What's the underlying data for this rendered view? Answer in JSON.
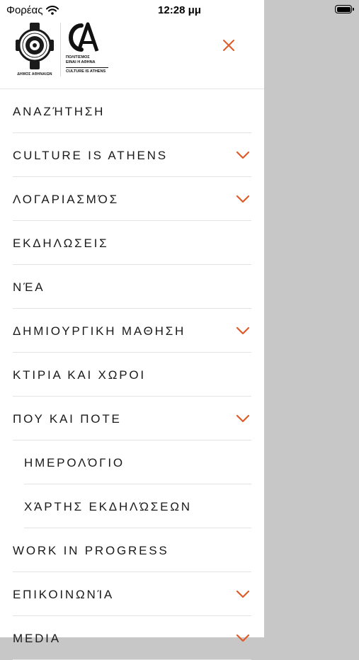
{
  "status_bar": {
    "carrier": "Φορέας",
    "time": "12:28 μμ"
  },
  "header": {
    "dimos_caption": "ΔΗΜΟΣ ΑΘΗΝΑΙΩΝ",
    "ca_line1": "ΠΟΛΙΤΙΣΜΟΣ",
    "ca_line2": "ΕΙΝΑΙ Η ΑΘΗΝΑ",
    "ca_line3": "CULTURE IS ATHENS",
    "close_icon": "close-icon"
  },
  "colors": {
    "accent": "#e05a28",
    "overlay": "#c7c7c7",
    "text": "#1a1a1a"
  },
  "menu": {
    "items": [
      {
        "label": "ΑΝΑΖΉΤΗΣΗ",
        "expandable": false
      },
      {
        "label": "CULTURE IS ATHENS",
        "expandable": true
      },
      {
        "label": "ΛΟΓΑΡΙΑΣΜΌΣ",
        "expandable": true
      },
      {
        "label": "ΕΚΔΗΛΩΣΕΙΣ",
        "expandable": false
      },
      {
        "label": "ΝΈΑ",
        "expandable": false
      },
      {
        "label": "ΔΗΜΙΟΥΡΓΙΚΗ ΜΑΘΗΣΗ",
        "expandable": true
      },
      {
        "label": "ΚΤΙΡΙΑ ΚΑΙ ΧΩΡΟΙ",
        "expandable": false
      },
      {
        "label": "ΠΟΥ ΚΑΙ ΠΟΤΕ",
        "expandable": true
      },
      {
        "label": "ΗΜΕΡΟΛΌΓΙΟ",
        "expandable": false,
        "sub": true
      },
      {
        "label": "ΧΆΡΤΗΣ ΕΚΔΗΛΏΣΕΩΝ",
        "expandable": false,
        "sub": true
      },
      {
        "label": "WORK IN PROGRESS",
        "expandable": false
      },
      {
        "label": "ΕΠΙΚΟΙΝΩΝΊΑ",
        "expandable": true
      },
      {
        "label": "MEDIA",
        "expandable": true
      }
    ]
  }
}
